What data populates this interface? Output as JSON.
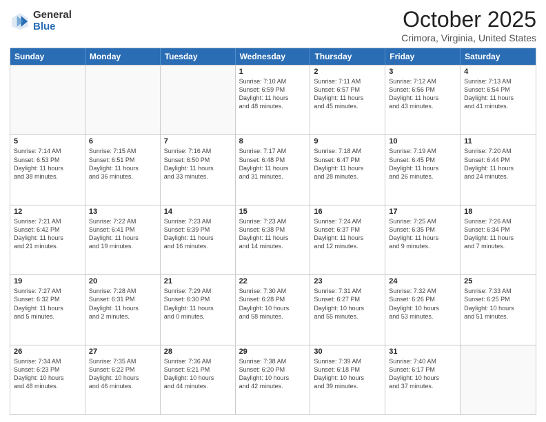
{
  "logo": {
    "general": "General",
    "blue": "Blue"
  },
  "title": "October 2025",
  "location": "Crimora, Virginia, United States",
  "days_of_week": [
    "Sunday",
    "Monday",
    "Tuesday",
    "Wednesday",
    "Thursday",
    "Friday",
    "Saturday"
  ],
  "weeks": [
    [
      {
        "day": "",
        "info": "",
        "empty": true
      },
      {
        "day": "",
        "info": "",
        "empty": true
      },
      {
        "day": "",
        "info": "",
        "empty": true
      },
      {
        "day": "1",
        "info": "Sunrise: 7:10 AM\nSunset: 6:59 PM\nDaylight: 11 hours\nand 48 minutes."
      },
      {
        "day": "2",
        "info": "Sunrise: 7:11 AM\nSunset: 6:57 PM\nDaylight: 11 hours\nand 45 minutes."
      },
      {
        "day": "3",
        "info": "Sunrise: 7:12 AM\nSunset: 6:56 PM\nDaylight: 11 hours\nand 43 minutes."
      },
      {
        "day": "4",
        "info": "Sunrise: 7:13 AM\nSunset: 6:54 PM\nDaylight: 11 hours\nand 41 minutes."
      }
    ],
    [
      {
        "day": "5",
        "info": "Sunrise: 7:14 AM\nSunset: 6:53 PM\nDaylight: 11 hours\nand 38 minutes."
      },
      {
        "day": "6",
        "info": "Sunrise: 7:15 AM\nSunset: 6:51 PM\nDaylight: 11 hours\nand 36 minutes."
      },
      {
        "day": "7",
        "info": "Sunrise: 7:16 AM\nSunset: 6:50 PM\nDaylight: 11 hours\nand 33 minutes."
      },
      {
        "day": "8",
        "info": "Sunrise: 7:17 AM\nSunset: 6:48 PM\nDaylight: 11 hours\nand 31 minutes."
      },
      {
        "day": "9",
        "info": "Sunrise: 7:18 AM\nSunset: 6:47 PM\nDaylight: 11 hours\nand 28 minutes."
      },
      {
        "day": "10",
        "info": "Sunrise: 7:19 AM\nSunset: 6:45 PM\nDaylight: 11 hours\nand 26 minutes."
      },
      {
        "day": "11",
        "info": "Sunrise: 7:20 AM\nSunset: 6:44 PM\nDaylight: 11 hours\nand 24 minutes."
      }
    ],
    [
      {
        "day": "12",
        "info": "Sunrise: 7:21 AM\nSunset: 6:42 PM\nDaylight: 11 hours\nand 21 minutes."
      },
      {
        "day": "13",
        "info": "Sunrise: 7:22 AM\nSunset: 6:41 PM\nDaylight: 11 hours\nand 19 minutes."
      },
      {
        "day": "14",
        "info": "Sunrise: 7:23 AM\nSunset: 6:39 PM\nDaylight: 11 hours\nand 16 minutes."
      },
      {
        "day": "15",
        "info": "Sunrise: 7:23 AM\nSunset: 6:38 PM\nDaylight: 11 hours\nand 14 minutes."
      },
      {
        "day": "16",
        "info": "Sunrise: 7:24 AM\nSunset: 6:37 PM\nDaylight: 11 hours\nand 12 minutes."
      },
      {
        "day": "17",
        "info": "Sunrise: 7:25 AM\nSunset: 6:35 PM\nDaylight: 11 hours\nand 9 minutes."
      },
      {
        "day": "18",
        "info": "Sunrise: 7:26 AM\nSunset: 6:34 PM\nDaylight: 11 hours\nand 7 minutes."
      }
    ],
    [
      {
        "day": "19",
        "info": "Sunrise: 7:27 AM\nSunset: 6:32 PM\nDaylight: 11 hours\nand 5 minutes."
      },
      {
        "day": "20",
        "info": "Sunrise: 7:28 AM\nSunset: 6:31 PM\nDaylight: 11 hours\nand 2 minutes."
      },
      {
        "day": "21",
        "info": "Sunrise: 7:29 AM\nSunset: 6:30 PM\nDaylight: 11 hours\nand 0 minutes."
      },
      {
        "day": "22",
        "info": "Sunrise: 7:30 AM\nSunset: 6:28 PM\nDaylight: 10 hours\nand 58 minutes."
      },
      {
        "day": "23",
        "info": "Sunrise: 7:31 AM\nSunset: 6:27 PM\nDaylight: 10 hours\nand 55 minutes."
      },
      {
        "day": "24",
        "info": "Sunrise: 7:32 AM\nSunset: 6:26 PM\nDaylight: 10 hours\nand 53 minutes."
      },
      {
        "day": "25",
        "info": "Sunrise: 7:33 AM\nSunset: 6:25 PM\nDaylight: 10 hours\nand 51 minutes."
      }
    ],
    [
      {
        "day": "26",
        "info": "Sunrise: 7:34 AM\nSunset: 6:23 PM\nDaylight: 10 hours\nand 48 minutes."
      },
      {
        "day": "27",
        "info": "Sunrise: 7:35 AM\nSunset: 6:22 PM\nDaylight: 10 hours\nand 46 minutes."
      },
      {
        "day": "28",
        "info": "Sunrise: 7:36 AM\nSunset: 6:21 PM\nDaylight: 10 hours\nand 44 minutes."
      },
      {
        "day": "29",
        "info": "Sunrise: 7:38 AM\nSunset: 6:20 PM\nDaylight: 10 hours\nand 42 minutes."
      },
      {
        "day": "30",
        "info": "Sunrise: 7:39 AM\nSunset: 6:18 PM\nDaylight: 10 hours\nand 39 minutes."
      },
      {
        "day": "31",
        "info": "Sunrise: 7:40 AM\nSunset: 6:17 PM\nDaylight: 10 hours\nand 37 minutes."
      },
      {
        "day": "",
        "info": "",
        "empty": true
      }
    ]
  ]
}
